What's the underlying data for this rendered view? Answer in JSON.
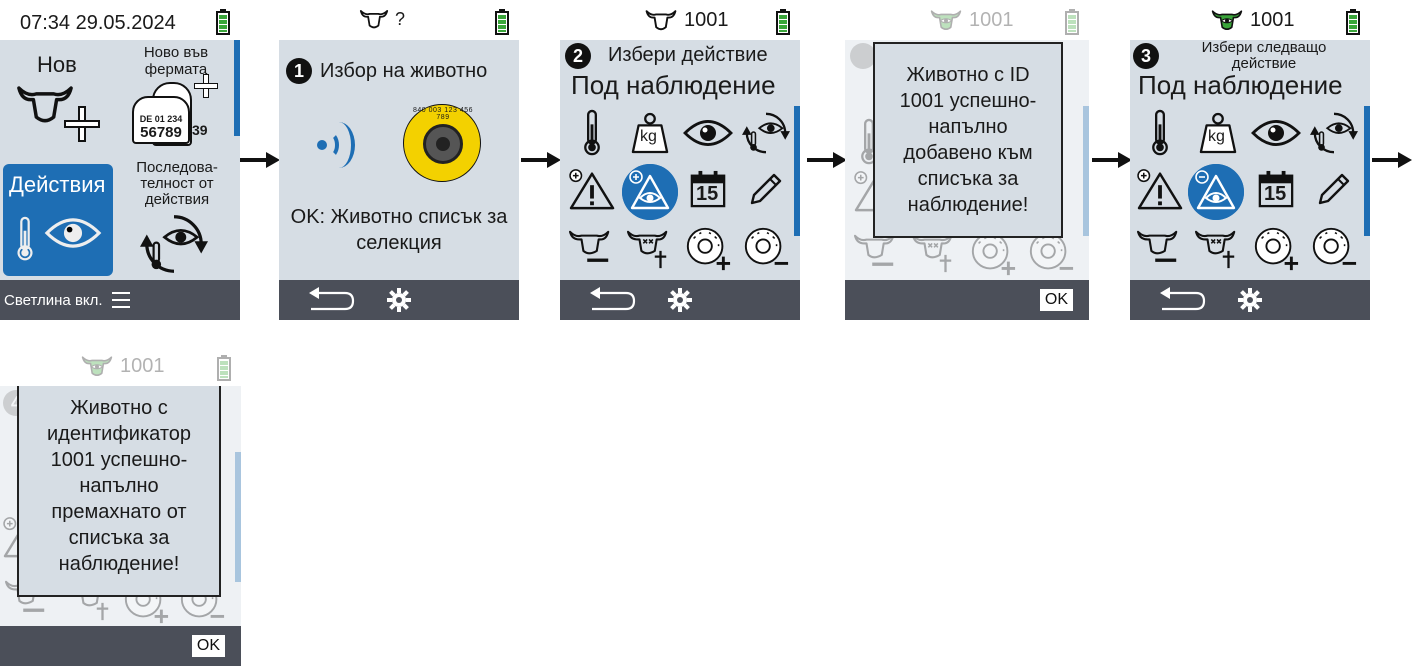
{
  "screens": [
    {
      "status": {
        "time": "07:34 29.05.2024"
      },
      "tiles": {
        "new": "Нов",
        "new_on_farm": "Ново във фермата",
        "tag_text_top": "DE 01 234",
        "tag_text_bottom": "56789",
        "tag_text_side": "39",
        "actions": "Действия",
        "sequence": "Последова-телност от действия"
      },
      "footer": {
        "label": "Светлина вкл."
      }
    },
    {
      "status": {
        "animal_id": "?"
      },
      "step": "1",
      "heading": "Избор на животно",
      "tag_number": "840 003 123 456 789",
      "ok_text": "OK: Животно списък за селекция"
    },
    {
      "status": {
        "animal_id": "1001"
      },
      "step": "2",
      "heading": "Избери действие",
      "title": "Под наблюдение",
      "kg_label": "kg",
      "calendar_day": "15"
    },
    {
      "status": {
        "animal_id": "1001"
      },
      "popup": "Животно с ID 1001 успешно-напълно добавено към списъка за наблюдение!",
      "footer": {
        "ok": "OK"
      }
    },
    {
      "status": {
        "animal_id": "1001"
      },
      "step": "3",
      "heading": "Избери следващо действие",
      "title": "Под наблюдение",
      "kg_label": "kg",
      "calendar_day": "15"
    },
    {
      "status": {
        "animal_id": "1001"
      },
      "step": "4",
      "popup": "Животно с идентификатор 1001 успешно-напълно премахнато от списъка за наблюдение!",
      "footer": {
        "ok": "OK"
      }
    }
  ],
  "colors": {
    "accent": "#1e6eb4",
    "screen_bg": "#d6dde4",
    "footer_bg": "#4b4f59",
    "battery": "#3aa53a",
    "watch_green": "#3aa53a"
  }
}
